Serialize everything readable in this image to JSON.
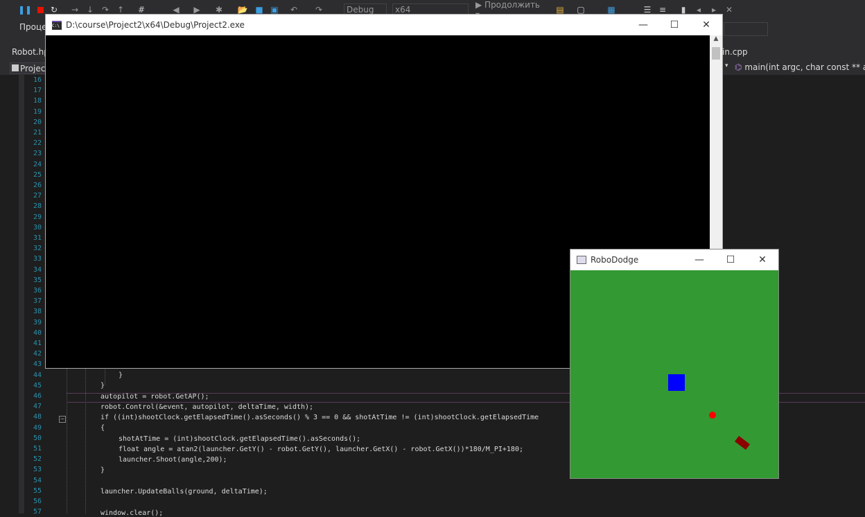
{
  "toolbar": {
    "config": "Debug",
    "platform": "x64",
    "continue_label": "▶ Продолжить ▾"
  },
  "toolbar2": {
    "process_label": "Проце"
  },
  "tabs": {
    "left": "Robot.hp",
    "right": "in.cpp"
  },
  "nav": {
    "project_label": "Projec",
    "function_label": "main(int argc, char const ** argv"
  },
  "console_window": {
    "title": "D:\\course\\Project2\\x64\\Debug\\Project2.exe",
    "icon_text": "C:\\"
  },
  "game_window": {
    "title": "RoboDodge",
    "bg_color": "#339933",
    "robot_color": "#0000ff",
    "ball_color": "#ff0000",
    "launcher_color": "#8b0000"
  },
  "line_numbers": [
    "16",
    "17",
    "18",
    "19",
    "20",
    "21",
    "22",
    "23",
    "24",
    "25",
    "26",
    "27",
    "28",
    "29",
    "30",
    "31",
    "32",
    "33",
    "34",
    "35",
    "36",
    "37",
    "38",
    "39",
    "40",
    "41",
    "42",
    "43",
    "44",
    "45",
    "46",
    "47",
    "48",
    "49",
    "50",
    "51",
    "52",
    "53",
    "54",
    "55",
    "56",
    "57"
  ],
  "code_lines": {
    "l44": "}",
    "l45": "}",
    "l46": "autopilot = robot.GetAP();",
    "l47": "robot.Control(&event, autopilot, deltaTime, width);",
    "l48": "if ((int)shootClock.getElapsedTime().asSeconds() % 3 == 0 && shotAtTime != (int)shootClock.getElapsedTime",
    "l49": "{",
    "l50": "shotAtTime = (int)shootClock.getElapsedTime().asSeconds();",
    "l51": "float angle = atan2(launcher.GetY() - robot.GetY(), launcher.GetX() - robot.GetX())*180/M_PI+180;",
    "l52": "launcher.Shoot(angle,200);",
    "l53": "}",
    "l55": "launcher.UpdateBalls(ground, deltaTime);",
    "l57": "window.clear();"
  }
}
